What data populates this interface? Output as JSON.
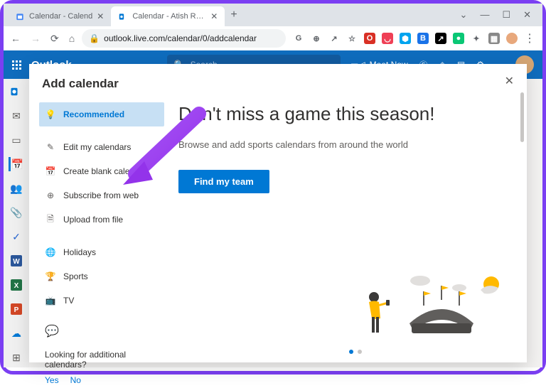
{
  "browser": {
    "tabs": [
      {
        "title": "Calendar - Calend",
        "favicon": "gcal"
      },
      {
        "title": "Calendar - Atish Rajasekharan - C",
        "favicon": "outlook",
        "active": true
      }
    ],
    "url": "outlook.live.com/calendar/0/addcalendar"
  },
  "outlook": {
    "title": "Outlook",
    "search_placeholder": "Search",
    "meet_now": "Meet Now"
  },
  "modal": {
    "title": "Add calendar",
    "menu": {
      "recommended": "Recommended",
      "edit": "Edit my calendars",
      "blank": "Create blank calendar",
      "subscribe": "Subscribe from web",
      "upload": "Upload from file",
      "holidays": "Holidays",
      "sports": "Sports",
      "tv": "TV"
    },
    "additional": {
      "prompt": "Looking for additional calendars?",
      "yes": "Yes",
      "no": "No"
    },
    "main": {
      "heading": "Don't miss a game this season!",
      "sub": "Browse and add sports calendars from around the world",
      "button": "Find my team"
    }
  }
}
